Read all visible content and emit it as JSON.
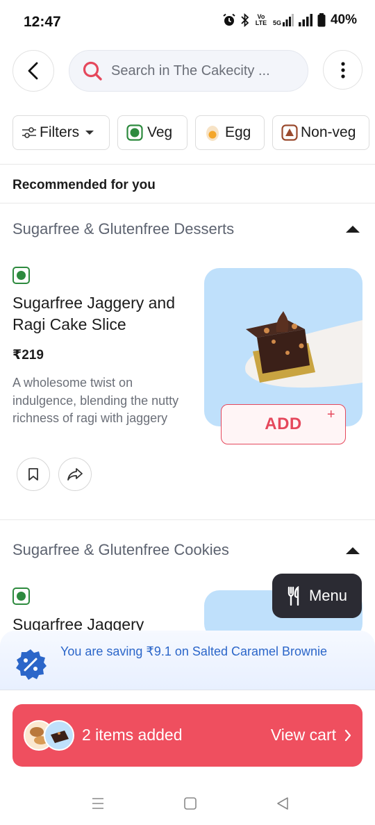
{
  "status_bar": {
    "time": "12:47",
    "network_label": "Vo LTE",
    "network_gen": "5G",
    "battery": "40%"
  },
  "header": {
    "search_placeholder": "Search in The Cakecity ..."
  },
  "filters": {
    "filters_label": "Filters",
    "veg_label": "Veg",
    "egg_label": "Egg",
    "nonveg_label": "Non-veg"
  },
  "recommended_title": "Recommended for you",
  "categories": [
    {
      "title": "Sugarfree & Glutenfree Desserts",
      "item": {
        "name": "Sugarfree Jaggery and Ragi Cake Slice",
        "price": "₹219",
        "description": "A wholesome twist on indulgence, blending the nutty richness of ragi with jaggery",
        "add_label": "ADD",
        "add_plus": "+"
      }
    },
    {
      "title": "Sugarfree & Glutenfree Cookies",
      "item": {
        "name": "Sugarfree Jaggery"
      }
    }
  ],
  "menu_button": "Menu",
  "savings_text": "You are saving ₹9.1 on Salted Caramel Brownie",
  "cart": {
    "count_text": "2 items added",
    "view_cart": "View cart"
  },
  "colors": {
    "accent": "#ef4f5f",
    "veg": "#2d8a3e",
    "savings_text": "#2b66c9"
  }
}
